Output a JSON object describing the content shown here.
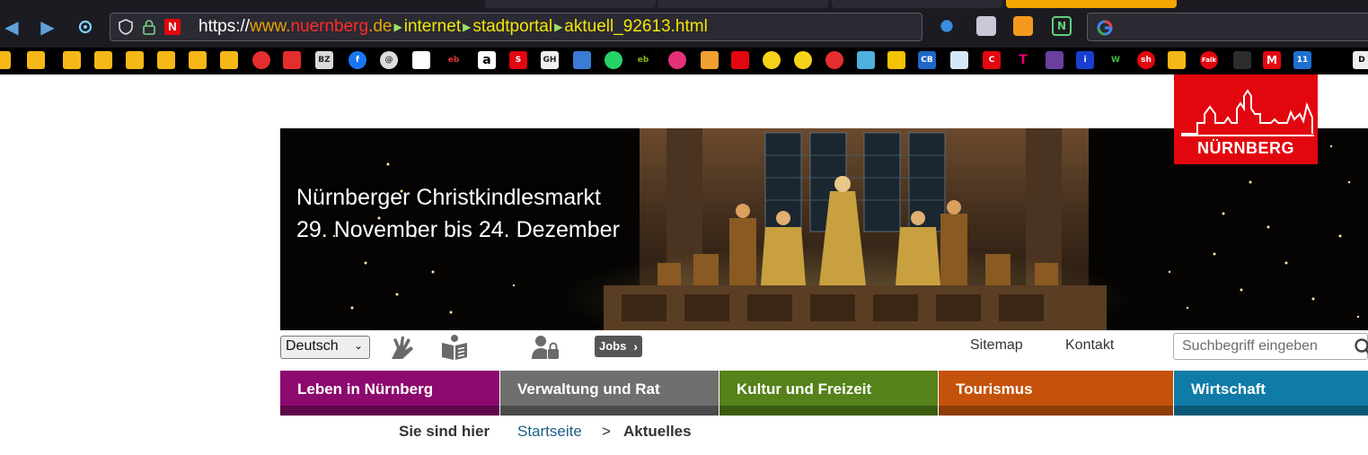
{
  "browser": {
    "url": {
      "scheme": "https://",
      "sub": "www.",
      "highlight": "nuernberg",
      "tld": ".de",
      "segments": [
        "internet",
        "stadtportal",
        "aktuell_92613.html"
      ]
    },
    "colors": {
      "chrome": "#1c1b22",
      "active_tab": "#f6a600"
    },
    "bookmark_icons": [
      "folder-icon",
      "youtube-icon",
      "bz-icon",
      "facebook-icon",
      "ebay-icon",
      "amazon-icon",
      "sparkasse-icon",
      "whatsapp-icon",
      "telekom-icon",
      "m-icon"
    ]
  },
  "logo": {
    "text": "NÜRNBERG",
    "color": "#e2060f"
  },
  "hero": {
    "line1": "Nürnberger Christkindlesmarkt",
    "line2": "29. November bis 24. Dezember"
  },
  "toolbar": {
    "language": "Deutsch",
    "icons": [
      "sign-language-icon",
      "easy-language-icon",
      "login-lock-icon"
    ],
    "jobs_label": "Jobs",
    "sitemap": "Sitemap",
    "kontakt": "Kontakt",
    "search_placeholder": "Suchbegriff eingeben"
  },
  "nav": {
    "items": [
      {
        "label": "Leben in Nürnberg",
        "color": "#8c0a6e",
        "bar": "#5e0749"
      },
      {
        "label": "Verwaltung und Rat",
        "color": "#6f6f6f",
        "bar": "#4b4b4b"
      },
      {
        "label": "Kultur und Freizeit",
        "color": "#55821a",
        "bar": "#3a5c10"
      },
      {
        "label": "Tourismus",
        "color": "#c4520b",
        "bar": "#8f3c08"
      },
      {
        "label": "Wirtschaft",
        "color": "#0f7ba6",
        "bar": "#0a5876"
      }
    ]
  },
  "breadcrumb": {
    "label": "Sie sind hier",
    "home": "Startseite",
    "separator": ">",
    "current": "Aktuelles"
  }
}
